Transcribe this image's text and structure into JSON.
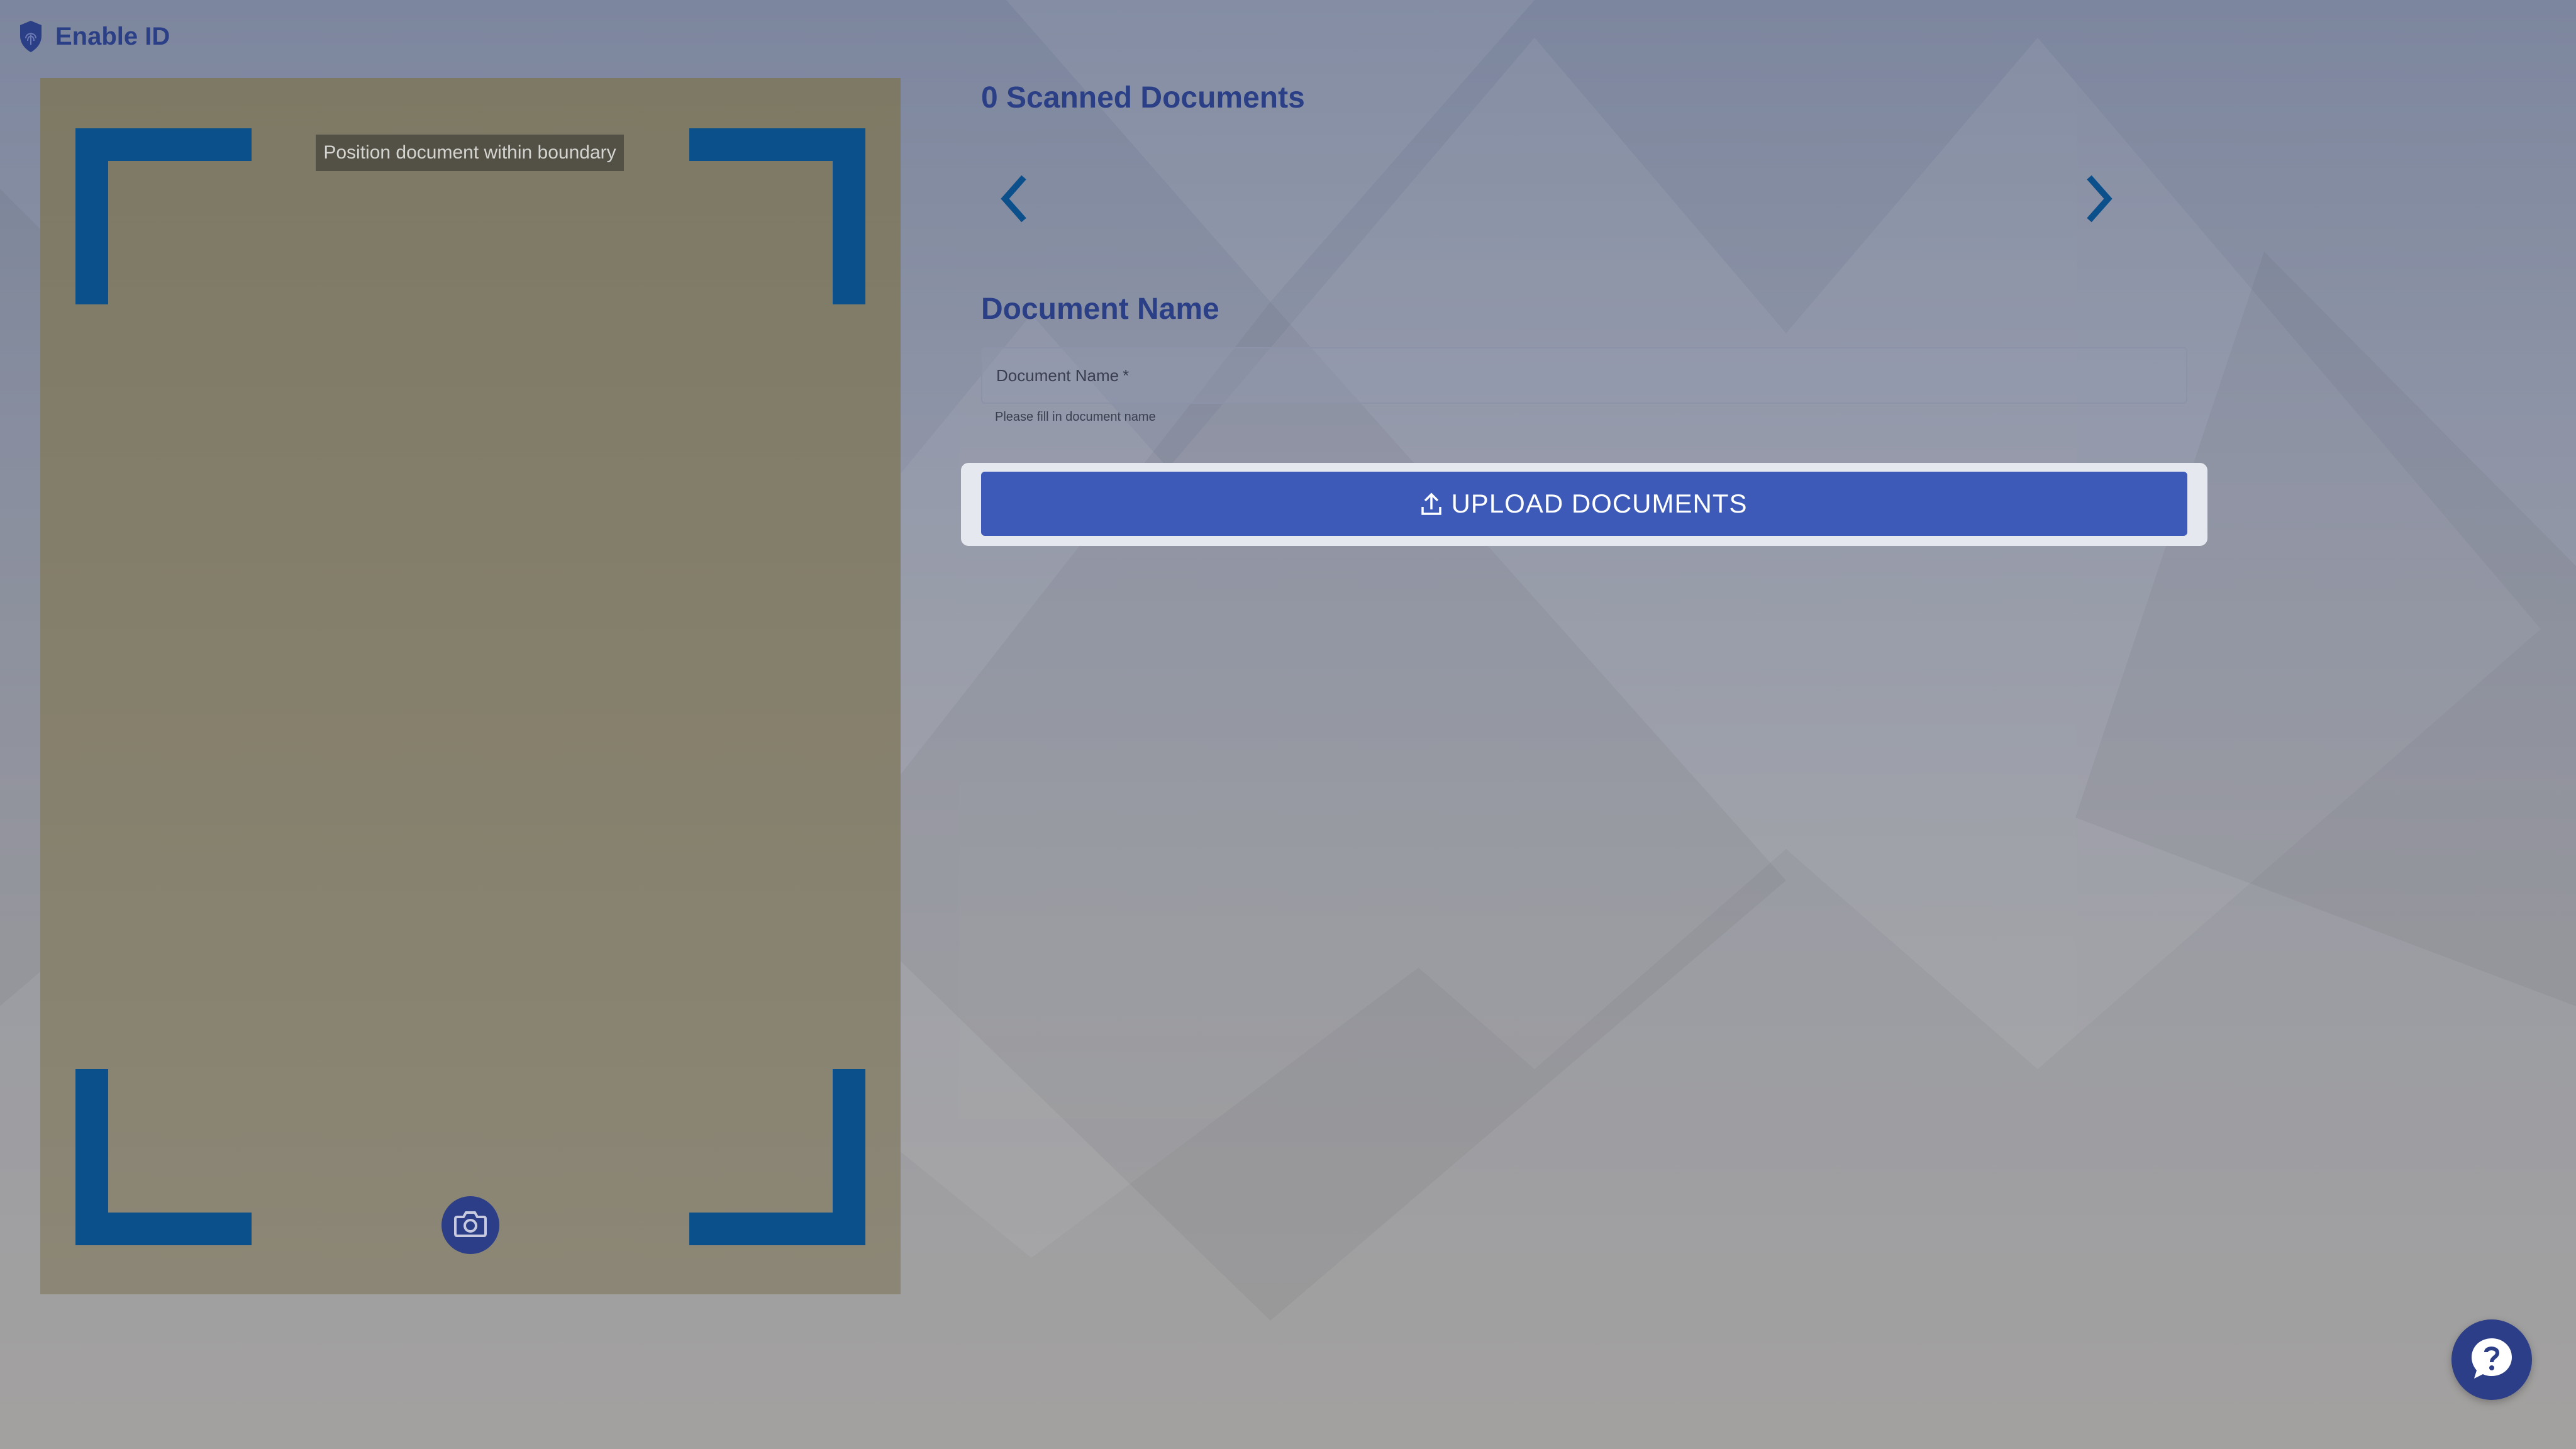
{
  "header": {
    "title": "Enable ID",
    "logo_icon": "fingerprint-shield-icon"
  },
  "camera": {
    "hint": "Position document within boundary",
    "shutter_icon": "camera-icon",
    "frame_color": "#0b4f8b"
  },
  "documents": {
    "title": "0 Scanned Documents",
    "prev_icon": "chevron-left-icon",
    "next_icon": "chevron-right-icon"
  },
  "document_name": {
    "heading": "Document Name",
    "field_label": "Document Name",
    "required_mark": "*",
    "value": "",
    "helper": "Please fill in document name"
  },
  "upload": {
    "label": "UPLOAD DOCUMENTS",
    "icon": "upload-icon",
    "color": "#3d5ab8"
  },
  "help": {
    "icon": "help-chat-icon"
  },
  "colors": {
    "brand": "#2b3f86",
    "accent": "#3d5ab8"
  }
}
